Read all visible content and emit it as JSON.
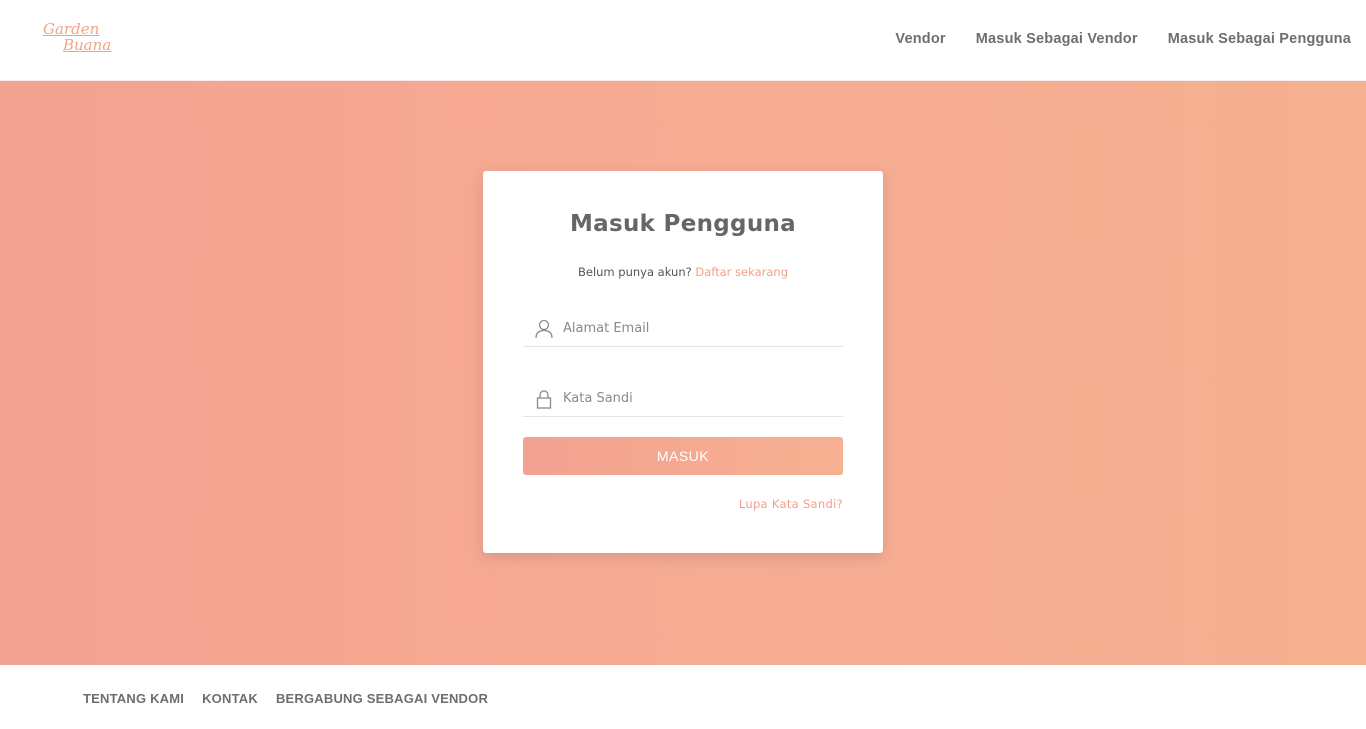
{
  "brand": {
    "line1": "Garden",
    "line2": "Buana"
  },
  "nav": {
    "items": [
      {
        "label": "Vendor"
      },
      {
        "label": "Masuk Sebagai Vendor"
      },
      {
        "label": "Masuk Sebagai Pengguna"
      }
    ]
  },
  "login": {
    "title": "Masuk Pengguna",
    "signup_prompt": "Belum punya akun?",
    "signup_link": "Daftar sekarang",
    "email": {
      "placeholder": "Alamat Email",
      "value": "",
      "icon": "user-icon"
    },
    "password": {
      "placeholder": "Kata Sandi",
      "value": "",
      "icon": "lock-icon"
    },
    "submit_label": "MASUK",
    "forgot_link": "Lupa Kata Sandi?"
  },
  "footer": {
    "links": [
      {
        "label": "TENTANG KAMI"
      },
      {
        "label": "KONTAK"
      },
      {
        "label": "BERGABUNG SEBAGAI VENDOR"
      }
    ]
  },
  "colors": {
    "accent": "#f2a08a",
    "hero_start": "#f4a292",
    "hero_end": "#f5b090",
    "text_dark": "#666666"
  }
}
